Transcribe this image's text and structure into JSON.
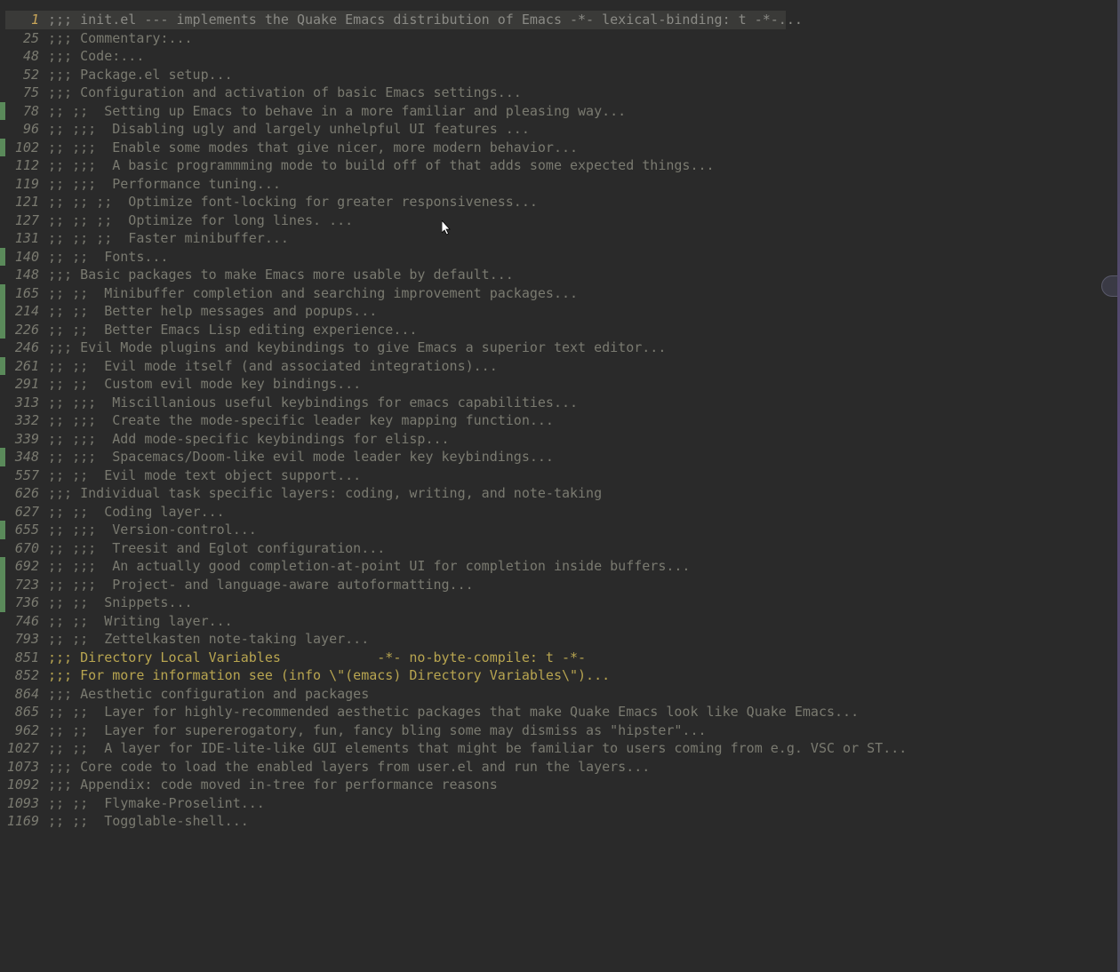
{
  "lines": [
    {
      "num": "1",
      "mark": false,
      "current": true,
      "yellow": false,
      "text": ";;; init.el --- implements the Quake Emacs distribution of Emacs -*- lexical-binding: t -*-...",
      "hlwidth": 878
    },
    {
      "num": "25",
      "mark": false,
      "current": false,
      "yellow": false,
      "text": ";;; Commentary:..."
    },
    {
      "num": "48",
      "mark": false,
      "current": false,
      "yellow": false,
      "text": ";;; Code:..."
    },
    {
      "num": "52",
      "mark": false,
      "current": false,
      "yellow": false,
      "text": ";;; Package.el setup..."
    },
    {
      "num": "75",
      "mark": false,
      "current": false,
      "yellow": false,
      "text": ";;; Configuration and activation of basic Emacs settings..."
    },
    {
      "num": "78",
      "mark": true,
      "current": false,
      "yellow": false,
      "text": ";; ;;  Setting up Emacs to behave in a more familiar and pleasing way..."
    },
    {
      "num": "96",
      "mark": false,
      "current": false,
      "yellow": false,
      "text": ";; ;;;  Disabling ugly and largely unhelpful UI features ..."
    },
    {
      "num": "102",
      "mark": true,
      "current": false,
      "yellow": false,
      "text": ";; ;;;  Enable some modes that give nicer, more modern behavior..."
    },
    {
      "num": "112",
      "mark": false,
      "current": false,
      "yellow": false,
      "text": ";; ;;;  A basic programmming mode to build off of that adds some expected things..."
    },
    {
      "num": "119",
      "mark": false,
      "current": false,
      "yellow": false,
      "text": ";; ;;;  Performance tuning..."
    },
    {
      "num": "121",
      "mark": false,
      "current": false,
      "yellow": false,
      "text": ";; ;; ;;  Optimize font-locking for greater responsiveness..."
    },
    {
      "num": "127",
      "mark": false,
      "current": false,
      "yellow": false,
      "text": ";; ;; ;;  Optimize for long lines. ..."
    },
    {
      "num": "131",
      "mark": false,
      "current": false,
      "yellow": false,
      "text": ";; ;; ;;  Faster minibuffer..."
    },
    {
      "num": "140",
      "mark": true,
      "current": false,
      "yellow": false,
      "text": ";; ;;  Fonts..."
    },
    {
      "num": "148",
      "mark": false,
      "current": false,
      "yellow": false,
      "text": ";;; Basic packages to make Emacs more usable by default..."
    },
    {
      "num": "165",
      "mark": true,
      "current": false,
      "yellow": false,
      "text": ";; ;;  Minibuffer completion and searching improvement packages..."
    },
    {
      "num": "214",
      "mark": true,
      "current": false,
      "yellow": false,
      "text": ";; ;;  Better help messages and popups..."
    },
    {
      "num": "226",
      "mark": true,
      "current": false,
      "yellow": false,
      "text": ";; ;;  Better Emacs Lisp editing experience..."
    },
    {
      "num": "246",
      "mark": false,
      "current": false,
      "yellow": false,
      "text": ";;; Evil Mode plugins and keybindings to give Emacs a superior text editor..."
    },
    {
      "num": "261",
      "mark": true,
      "current": false,
      "yellow": false,
      "text": ";; ;;  Evil mode itself (and associated integrations)..."
    },
    {
      "num": "291",
      "mark": false,
      "current": false,
      "yellow": false,
      "text": ";; ;;  Custom evil mode key bindings..."
    },
    {
      "num": "313",
      "mark": false,
      "current": false,
      "yellow": false,
      "text": ";; ;;;  Miscillanious useful keybindings for emacs capabilities..."
    },
    {
      "num": "332",
      "mark": false,
      "current": false,
      "yellow": false,
      "text": ";; ;;;  Create the mode-specific leader key mapping function..."
    },
    {
      "num": "339",
      "mark": false,
      "current": false,
      "yellow": false,
      "text": ";; ;;;  Add mode-specific keybindings for elisp..."
    },
    {
      "num": "348",
      "mark": true,
      "current": false,
      "yellow": false,
      "text": ";; ;;;  Spacemacs/Doom-like evil mode leader key keybindings..."
    },
    {
      "num": "557",
      "mark": false,
      "current": false,
      "yellow": false,
      "text": ";; ;;  Evil mode text object support..."
    },
    {
      "num": "626",
      "mark": false,
      "current": false,
      "yellow": false,
      "text": ";;; Individual task specific layers: coding, writing, and note-taking"
    },
    {
      "num": "627",
      "mark": false,
      "current": false,
      "yellow": false,
      "text": ";; ;;  Coding layer..."
    },
    {
      "num": "655",
      "mark": true,
      "current": false,
      "yellow": false,
      "text": ";; ;;;  Version-control..."
    },
    {
      "num": "670",
      "mark": false,
      "current": false,
      "yellow": false,
      "text": ";; ;;;  Treesit and Eglot configuration..."
    },
    {
      "num": "692",
      "mark": true,
      "current": false,
      "yellow": false,
      "text": ";; ;;;  An actually good completion-at-point UI for completion inside buffers..."
    },
    {
      "num": "723",
      "mark": true,
      "current": false,
      "yellow": false,
      "text": ";; ;;;  Project- and language-aware autoformatting..."
    },
    {
      "num": "736",
      "mark": true,
      "current": false,
      "yellow": false,
      "text": ";; ;;  Snippets..."
    },
    {
      "num": "746",
      "mark": false,
      "current": false,
      "yellow": false,
      "text": ";; ;;  Writing layer..."
    },
    {
      "num": "793",
      "mark": false,
      "current": false,
      "yellow": false,
      "text": ";; ;;  Zettelkasten note-taking layer..."
    },
    {
      "num": "851",
      "mark": false,
      "current": false,
      "yellow": true,
      "text": ";;; Directory Local Variables            -*- no-byte-compile: t -*-"
    },
    {
      "num": "852",
      "mark": false,
      "current": false,
      "yellow": true,
      "text": ";;; For more information see (info \\\"(emacs) Directory Variables\\\")..."
    },
    {
      "num": "864",
      "mark": false,
      "current": false,
      "yellow": false,
      "text": ";;; Aesthetic configuration and packages"
    },
    {
      "num": "865",
      "mark": false,
      "current": false,
      "yellow": false,
      "text": ";; ;;  Layer for highly-recommended aesthetic packages that make Quake Emacs look like Quake Emacs..."
    },
    {
      "num": "962",
      "mark": false,
      "current": false,
      "yellow": false,
      "text": ";; ;;  Layer for supererogatory, fun, fancy bling some may dismiss as \"hipster\"..."
    },
    {
      "num": "1027",
      "mark": false,
      "current": false,
      "yellow": false,
      "text": ";; ;;  A layer for IDE-lite-like GUI elements that might be familiar to users coming from e.g. VSC or ST..."
    },
    {
      "num": "1073",
      "mark": false,
      "current": false,
      "yellow": false,
      "text": ";;; Core code to load the enabled layers from user.el and run the layers..."
    },
    {
      "num": "1092",
      "mark": false,
      "current": false,
      "yellow": false,
      "text": ";;; Appendix: code moved in-tree for performance reasons"
    },
    {
      "num": "1093",
      "mark": false,
      "current": false,
      "yellow": false,
      "text": ";; ;;  Flymake-Proselint..."
    },
    {
      "num": "1169",
      "mark": false,
      "current": false,
      "yellow": false,
      "text": ";; ;;  Togglable-shell..."
    }
  ]
}
